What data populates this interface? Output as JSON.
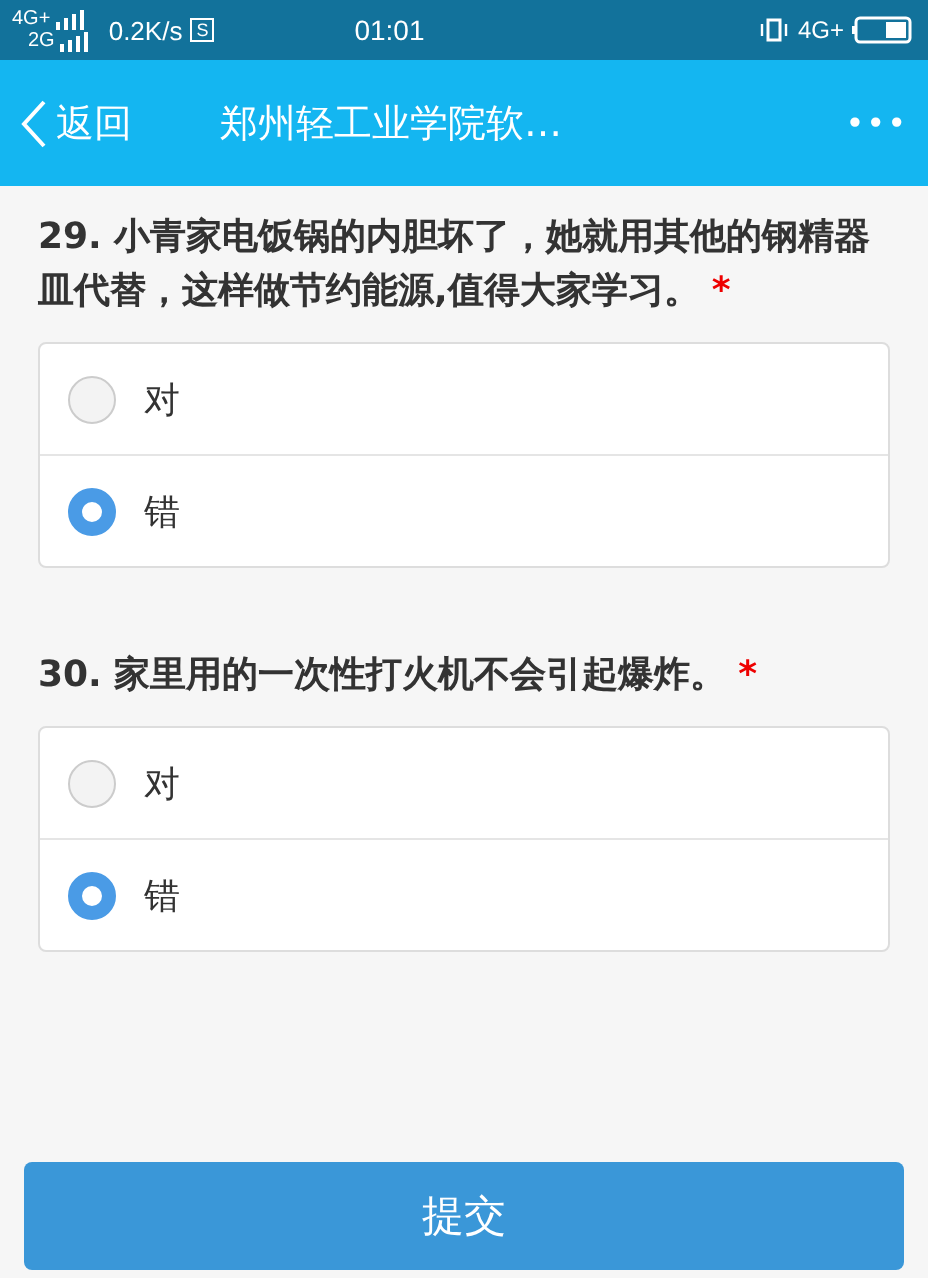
{
  "status_bar": {
    "network_top": "4G+",
    "network_bottom": "2G",
    "speed": "0.2K/s",
    "sim_badge": "S",
    "time": "01:01",
    "network_right": "4G+"
  },
  "nav": {
    "back": "返回",
    "title": "郑州轻工业学院软…",
    "more": "•••"
  },
  "questions": [
    {
      "text": "29. 小青家电饭锅的内胆坏了，她就用其他的钢精器皿代替，这样做节约能源,值得大家学习。",
      "required": "*",
      "options": [
        {
          "label": "对",
          "selected": false
        },
        {
          "label": "错",
          "selected": true
        }
      ]
    },
    {
      "text": "30. 家里用的一次性打火机不会引起爆炸。",
      "required": "*",
      "options": [
        {
          "label": "对",
          "selected": false
        },
        {
          "label": "错",
          "selected": true
        }
      ]
    }
  ],
  "submit": "提交"
}
